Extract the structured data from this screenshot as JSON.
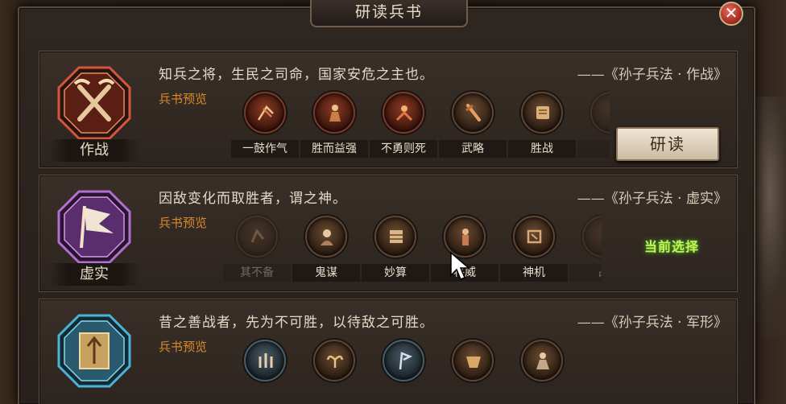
{
  "window": {
    "title": "研读兵书",
    "close_glyph": "✕"
  },
  "books": [
    {
      "emblem_label": "作战",
      "emblem_icon": "crossed-swords-icon",
      "emblem_color": "#b8402c",
      "quote": "知兵之将，生民之司命，国家安危之主也。",
      "source": "——《孙子兵法 · 作战》",
      "preview_label": "兵书预览",
      "skills": [
        {
          "name": "一鼓作气",
          "icon": "war-drum-icon"
        },
        {
          "name": "胜而益强",
          "icon": "general-icon"
        },
        {
          "name": "不勇则死",
          "icon": "warrior-icon"
        },
        {
          "name": "武略",
          "icon": "sword-icon"
        },
        {
          "name": "胜战",
          "icon": "scroll-icon"
        },
        {
          "name": "",
          "icon": "partial-icon"
        }
      ],
      "action_label": "研读"
    },
    {
      "emblem_label": "虚实",
      "emblem_icon": "banner-icon",
      "emblem_color": "#8a4aa8",
      "quote": "因敌变化而取胜者，谓之神。",
      "source": "——《孙子兵法 · 虚实》",
      "preview_label": "兵书预览",
      "skills": [
        {
          "name": "其不备",
          "icon": "ambush-icon"
        },
        {
          "name": "鬼谋",
          "icon": "strategist-icon"
        },
        {
          "name": "妙算",
          "icon": "abacus-icon"
        },
        {
          "name": "将威",
          "icon": "commander-icon"
        },
        {
          "name": "神机",
          "icon": "machine-icon"
        },
        {
          "name": "占",
          "icon": "partial-icon"
        }
      ],
      "status_label": "当前选择"
    },
    {
      "emblem_label": "",
      "emblem_icon": "fortress-icon",
      "emblem_color": "#3a8aa8",
      "quote": "昔之善战者，先为不可胜，以待敌之可胜。",
      "source": "——《孙子兵法 · 军形》",
      "preview_label": "兵书预览",
      "skills": [
        {
          "name": "",
          "icon": "formation-icon"
        },
        {
          "name": "",
          "icon": "lotus-icon"
        },
        {
          "name": "",
          "icon": "banner-tower-icon"
        },
        {
          "name": "",
          "icon": "cauldron-icon"
        },
        {
          "name": "",
          "icon": "sage-icon"
        }
      ]
    }
  ]
}
